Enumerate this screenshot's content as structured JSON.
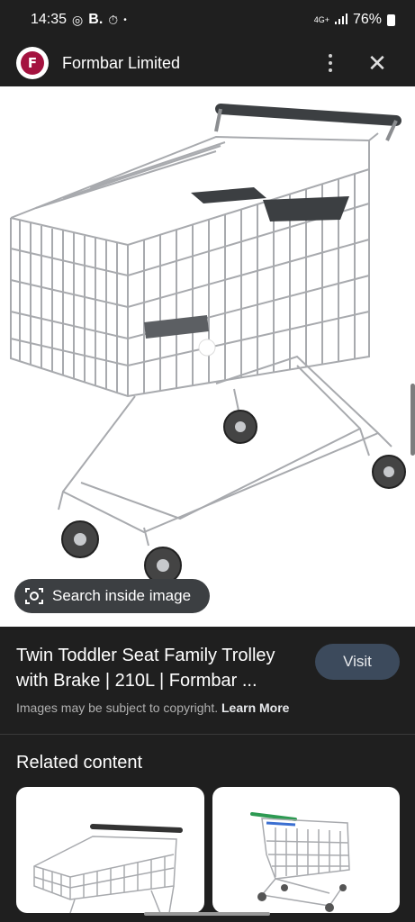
{
  "status_bar": {
    "time": "14:35",
    "notif_icons": [
      "whatsapp-icon",
      "b-app-icon",
      "alarm-icon",
      "dot-icon"
    ],
    "network": "4G+",
    "battery": "76%"
  },
  "header": {
    "site_name": "Formbar Limited",
    "logo_letter": "F"
  },
  "image": {
    "lens_label": "Search inside image"
  },
  "result": {
    "title": "Twin Toddler Seat Family Trolley with Brake | 210L | Formbar ...",
    "visit_label": "Visit",
    "copyright_text": "Images may be subject to copyright.",
    "learn_more": "Learn More"
  },
  "related": {
    "title": "Related content"
  },
  "colors": {
    "background": "#1f1f1f",
    "visit_button": "#3c4a5c",
    "logo": "#a4123f",
    "chip": "#3c3f42"
  }
}
